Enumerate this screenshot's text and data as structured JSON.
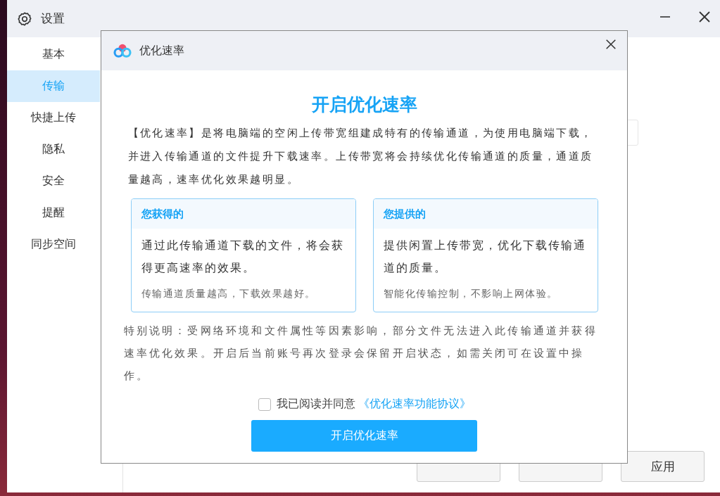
{
  "window": {
    "title": "设置"
  },
  "sidebar": {
    "items": [
      {
        "label": "基本",
        "selected": false
      },
      {
        "label": "传输",
        "selected": true
      },
      {
        "label": "快捷上传",
        "selected": false
      },
      {
        "label": "隐私",
        "selected": false
      },
      {
        "label": "安全",
        "selected": false
      },
      {
        "label": "提醒",
        "selected": false
      },
      {
        "label": "同步空间",
        "selected": false
      }
    ]
  },
  "footer_buttons": [
    "应用"
  ],
  "dialog": {
    "title": "优化速率",
    "heading": "开启优化速率",
    "description": "【优化速率】是将电脑端的空闲上传带宽组建成特有的传输通道，为使用电脑端下载，并进入传输通道的文件提升下载速率。上传带宽将会持续优化传输通道的质量，通道质量越高，速率优化效果越明显。",
    "cards": [
      {
        "title": "您获得的",
        "body": "通过此传输通道下载的文件，将会获得更高速率的效果。",
        "note": "传输通道质量越高，下载效果越好。"
      },
      {
        "title": "您提供的",
        "body": "提供闲置上传带宽，优化下载传输通道的质量。",
        "note": "智能化传输控制，不影响上网体验。"
      }
    ],
    "notice": "特别说明：受网络环境和文件属性等因素影响，部分文件无法进入此传输通道并获得速率优化效果。开启后当前账号再次登录会保留开启状态，如需关闭可在设置中操作。",
    "agreement": {
      "checked": false,
      "label": "我已阅读并同意",
      "link": "《优化速率功能协议》"
    },
    "button": "开启优化速率"
  }
}
